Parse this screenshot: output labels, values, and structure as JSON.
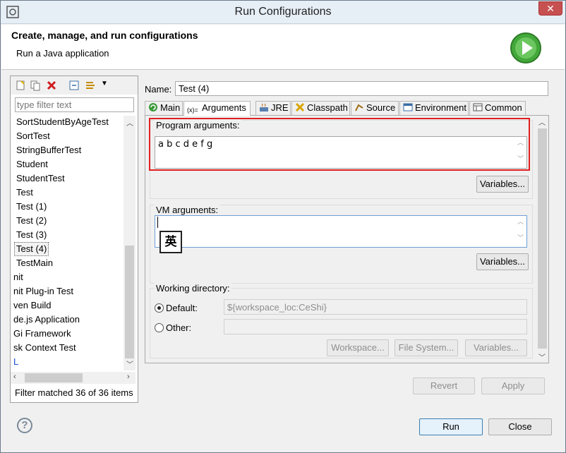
{
  "window": {
    "title": "Run Configurations"
  },
  "header": {
    "title": "Create, manage, and run configurations",
    "subtitle": "Run a Java application",
    "icon": "run-icon"
  },
  "sidebar": {
    "filter_placeholder": "type filter text",
    "items": [
      "SortStudentByAgeTest",
      "SortTest",
      "StringBufferTest",
      "Student",
      "StudentTest",
      "Test",
      "Test (1)",
      "Test (2)",
      "Test (3)",
      "Test (4)",
      "TestMain",
      "nit",
      "nit Plug-in Test",
      "ven Build",
      "de.js Application",
      "Gi Framework",
      "sk Context Test",
      "L"
    ],
    "selected": "Test (4)",
    "status": "Filter matched 36 of 36 items"
  },
  "config": {
    "name_label": "Name:",
    "name_value": "Test (4)",
    "tabs": [
      "Main",
      "Arguments",
      "JRE",
      "Classpath",
      "Source",
      "Environment",
      "Common"
    ],
    "active_tab": "Arguments",
    "program_args_label": "Program arguments:",
    "program_args_value": "a b c d e f g",
    "variables_label": "Variables...",
    "vm_args_label": "VM arguments:",
    "vm_args_value": "",
    "ime_indicator": "英",
    "working_dir_label": "Working directory:",
    "default_label": "Default:",
    "default_value": "${workspace_loc:CeShi}",
    "other_label": "Other:",
    "workspace_btn": "Workspace...",
    "filesystem_btn": "File System...",
    "variables_btn2": "Variables..."
  },
  "actions": {
    "revert": "Revert",
    "apply": "Apply",
    "run": "Run",
    "close": "Close"
  }
}
